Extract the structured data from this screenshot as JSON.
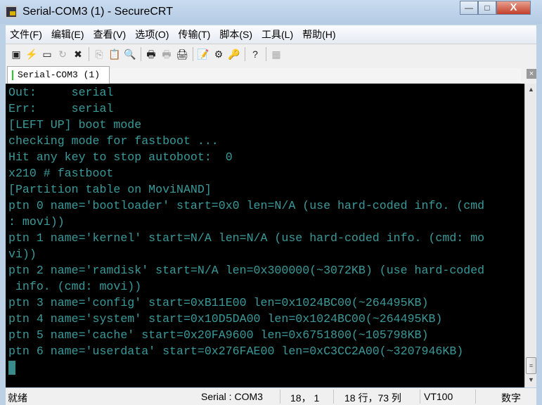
{
  "window": {
    "title": "Serial-COM3 (1) - SecureCRT",
    "minimize": "—",
    "maximize": "□",
    "close": "X"
  },
  "menu": [
    "文件(F)",
    "编辑(E)",
    "查看(V)",
    "选项(O)",
    "传输(T)",
    "脚本(S)",
    "工具(L)",
    "帮助(H)"
  ],
  "toolbar": [
    {
      "icon": "connect-icon",
      "glyph": "▣",
      "disabled": false
    },
    {
      "icon": "quick-connect-icon",
      "glyph": "⚡",
      "disabled": false
    },
    {
      "icon": "connect-tab-icon",
      "glyph": "▭",
      "disabled": false
    },
    {
      "icon": "reconnect-icon",
      "glyph": "↻",
      "disabled": true
    },
    {
      "icon": "disconnect-icon",
      "glyph": "✖",
      "disabled": false
    },
    {
      "sep": true
    },
    {
      "icon": "copy-icon",
      "glyph": "⎘",
      "disabled": true
    },
    {
      "icon": "paste-icon",
      "glyph": "📋",
      "disabled": false
    },
    {
      "icon": "find-icon",
      "glyph": "🔍",
      "disabled": false
    },
    {
      "sep": true
    },
    {
      "icon": "print-screen-icon",
      "glyph": "🖶",
      "disabled": false
    },
    {
      "icon": "print-selection-icon",
      "glyph": "🖶",
      "disabled": true
    },
    {
      "icon": "print-icon",
      "glyph": "🖨",
      "disabled": false
    },
    {
      "sep": true
    },
    {
      "icon": "session-options-icon",
      "glyph": "📝",
      "disabled": false
    },
    {
      "icon": "global-options-icon",
      "glyph": "⚙",
      "disabled": false
    },
    {
      "icon": "key-icon",
      "glyph": "🔑",
      "disabled": true
    },
    {
      "sep": true
    },
    {
      "icon": "help-icon",
      "glyph": "?",
      "disabled": false
    },
    {
      "sep": true
    },
    {
      "icon": "sftp-icon",
      "glyph": "▦",
      "disabled": true
    }
  ],
  "tab": {
    "label": "Serial-COM3 (1)",
    "close": "×"
  },
  "terminal": {
    "lines": [
      "Out:     serial",
      "Err:     serial",
      "[LEFT UP] boot mode",
      "checking mode for fastboot ...",
      "Hit any key to stop autoboot:  0",
      "x210 # fastboot",
      "[Partition table on MoviNAND]",
      "ptn 0 name='bootloader' start=0x0 len=N/A (use hard-coded info. (cmd",
      ": movi))",
      "ptn 1 name='kernel' start=N/A len=N/A (use hard-coded info. (cmd: mo",
      "vi))",
      "ptn 2 name='ramdisk' start=N/A len=0x300000(~3072KB) (use hard-coded",
      " info. (cmd: movi))",
      "ptn 3 name='config' start=0xB11E00 len=0x1024BC00(~264495KB)",
      "ptn 4 name='system' start=0x10D5DA00 len=0x1024BC00(~264495KB)",
      "ptn 5 name='cache' start=0x20FA9600 len=0x6751800(~105798KB)",
      "ptn 6 name='userdata' start=0x276FAE00 len=0xC3CC2A00(~3207946KB)"
    ],
    "text_color": "#3a9a9a"
  },
  "status": {
    "ready": "就绪",
    "connection": "Serial : COM3",
    "cursor": "18， 1",
    "size": "18 行，73 列",
    "emulation": "VT100",
    "num": "数字"
  }
}
